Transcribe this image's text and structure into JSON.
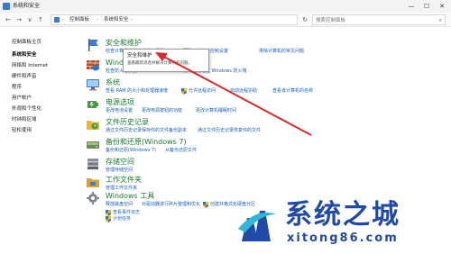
{
  "window": {
    "title": "系统和安全",
    "controls": {
      "minimize": "—",
      "maximize": "☐",
      "close": "✕"
    }
  },
  "address": {
    "back": "←",
    "forward": "→",
    "down": "∨",
    "up": "↑",
    "breadcrumbs": [
      "控制面板",
      "系统和安全"
    ],
    "separator": "›",
    "dropdown": "∨",
    "refresh": "↻"
  },
  "search": {
    "placeholder": "搜索控制面板",
    "icon": "⌕"
  },
  "sidebar": {
    "items": [
      {
        "label": "控制面板主页",
        "active": false
      },
      {
        "label": "系统和安全",
        "active": true
      },
      {
        "label": "网络和 Internet",
        "active": false
      },
      {
        "label": "硬件和声音",
        "active": false
      },
      {
        "label": "程序",
        "active": false
      },
      {
        "label": "用户帐户",
        "active": false
      },
      {
        "label": "外观和个性化",
        "active": false
      },
      {
        "label": "时钟和区域",
        "active": false
      },
      {
        "label": "轻松使用",
        "active": false
      }
    ]
  },
  "sections": [
    {
      "title": "安全和维护",
      "icon": "flag-icon",
      "links": [
        "检查计算机的状态并解决问题",
        "更改用户帐户控制设置",
        "排除计算机的常见问题"
      ]
    },
    {
      "title": "Windows Defender 防火墙",
      "icon": "firewall-icon",
      "links": [
        "检查防火墙状态",
        "允许应用通过 Windows 防火墙"
      ]
    },
    {
      "title": "系统",
      "icon": "computer-icon",
      "links": [
        "查看 RAM 的大小和处理器速度",
        "允许远程访问",
        "启动远程协助",
        "查看该计算机的名称"
      ]
    },
    {
      "title": "电源选项",
      "icon": "power-icon",
      "links": [
        "更改电池设置",
        "更改电源按钮的功能",
        "更改计算机睡眠时间"
      ]
    },
    {
      "title": "文件历史记录",
      "icon": "file-history-icon",
      "links": [
        "通过文件历史记录保存你的文件备份副本",
        "通过文件历史记录恢复你的文件"
      ]
    },
    {
      "title": "备份和还原(Windows 7)",
      "icon": "backup-icon",
      "links": [
        "备份和还原(Windows 7)",
        "从备份还原文件"
      ]
    },
    {
      "title": "存储空间",
      "icon": "storage-icon",
      "links": [
        "管理存储空间"
      ]
    },
    {
      "title": "工作文件夹",
      "icon": "work-folders-icon",
      "links": [
        "管理工作文件夹"
      ]
    },
    {
      "title": "Windows 工具",
      "icon": "tools-icon",
      "links": [
        "释放磁盘空间",
        "对驱动器进行碎片整理和优化",
        "创建并格式化硬盘分区",
        "查看事件日志",
        "计划任务"
      ]
    }
  ],
  "tooltip": {
    "title": "安全和维护",
    "description": "查看最新消息并解决计算机的问题。"
  },
  "watermark": {
    "title": "系统之城",
    "url": "xitong86.com"
  },
  "colors": {
    "accent": "#1b5fb0",
    "section_title": "#1a7a33",
    "arrow": "#d92b2b",
    "watermark": "#1f4aa7"
  }
}
